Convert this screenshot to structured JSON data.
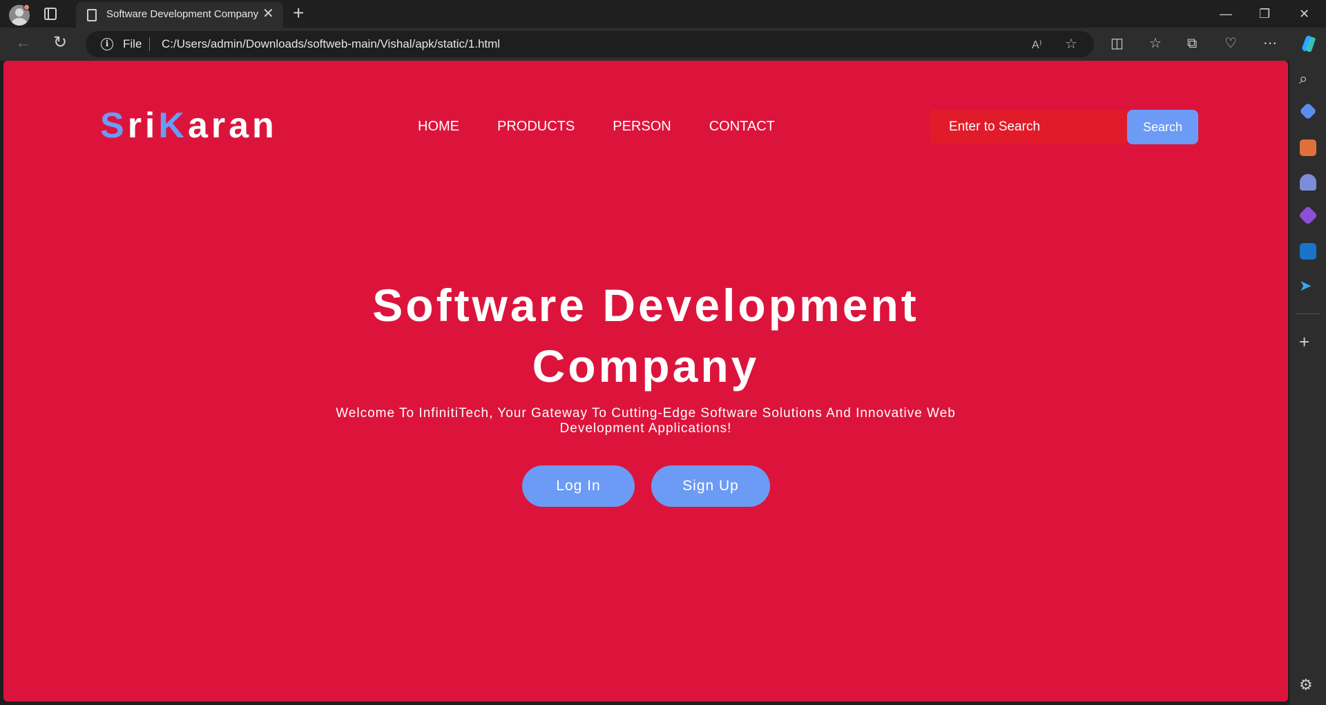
{
  "browser": {
    "tab_title": "Software Development Company",
    "tab_close": "✕",
    "new_tab": "+",
    "scheme_label": "File",
    "url": "C:/Users/admin/Downloads/softweb-main/Vishal/apk/static/1.html",
    "window_controls": {
      "minimize": "—",
      "restore": "❐",
      "close": "✕"
    }
  },
  "page": {
    "logo": {
      "s": "S",
      "ri": "ri",
      "k": "K",
      "aran": "aran"
    },
    "nav": [
      "HOME",
      "PRODUCTS",
      "PERSON",
      "CONTACT"
    ],
    "search": {
      "placeholder": "Enter to Search",
      "button": "Search"
    },
    "hero": {
      "title": "Software Development Company",
      "subtitle": "Welcome To InfinitiTech, Your Gateway To Cutting-Edge Software Solutions And Innovative Web Development Applications!",
      "login": "Log In",
      "signup": "Sign Up"
    }
  },
  "colors": {
    "page_background": "#dc143c",
    "accent_blue": "#6c9bf5",
    "search_field": "#e11b2a",
    "browser_chrome": "#1f1f1f"
  }
}
